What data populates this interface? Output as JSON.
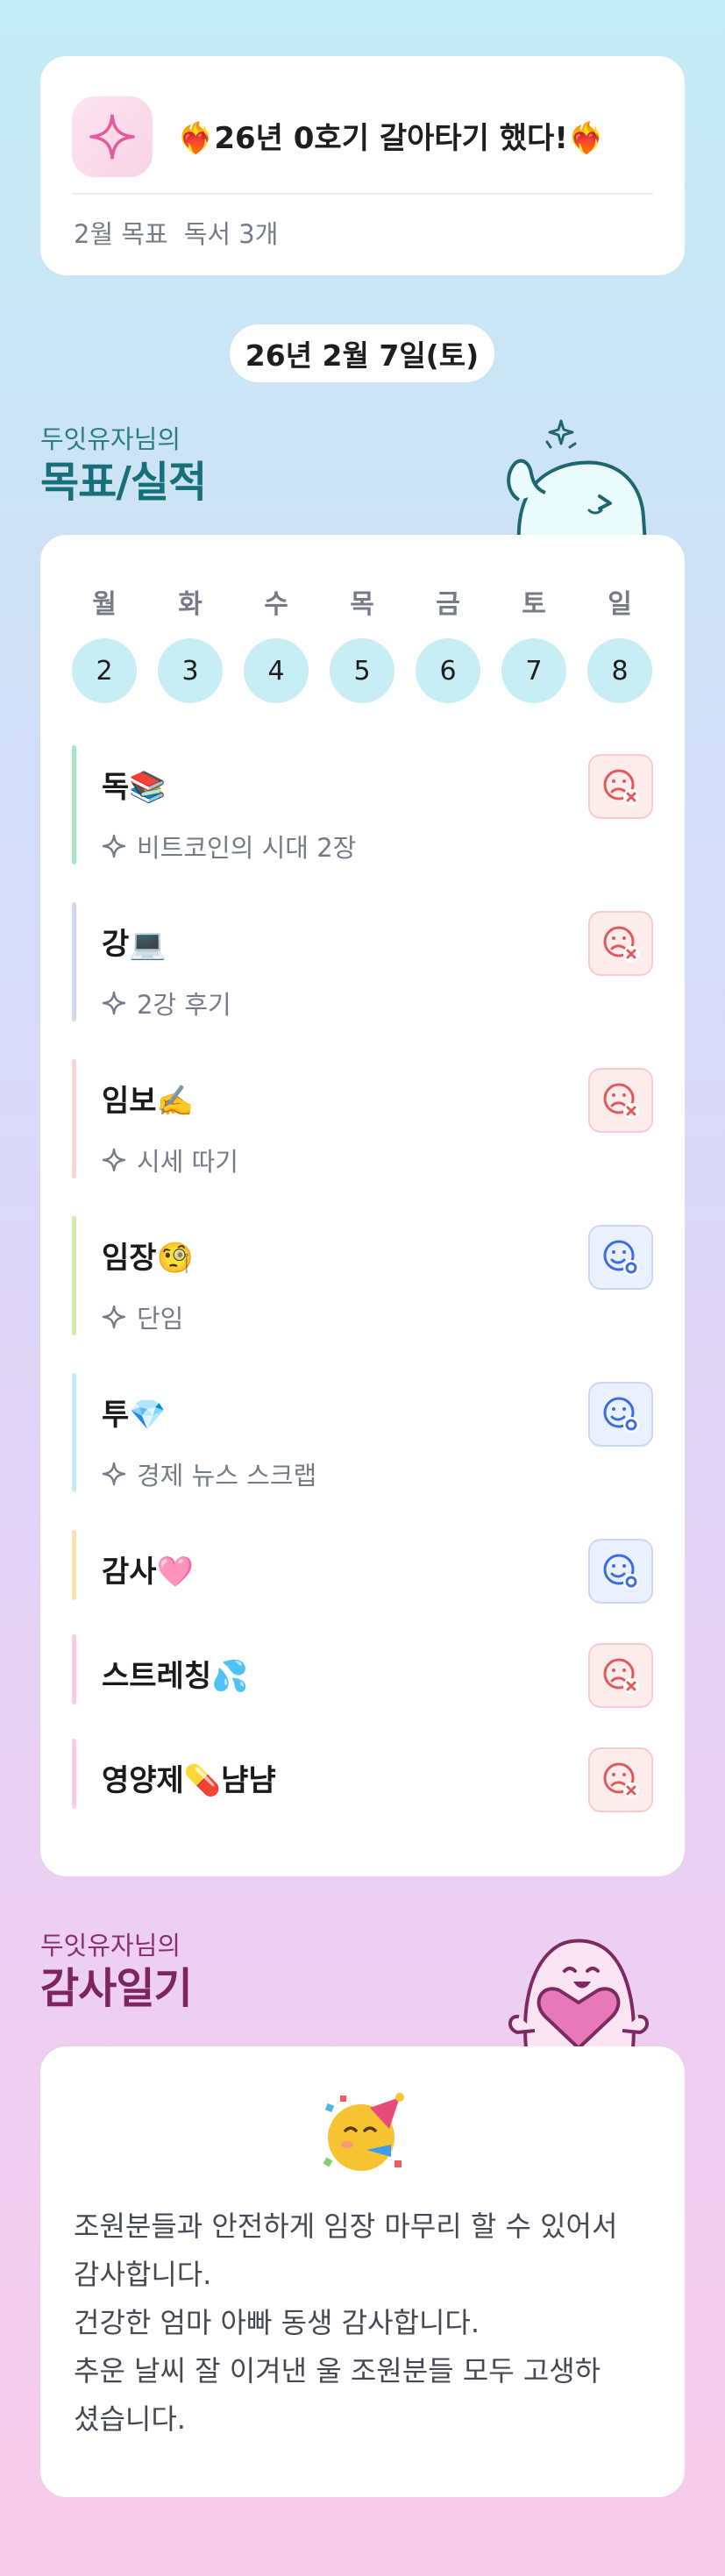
{
  "header": {
    "title": "❤️‍🔥26년 0호기 갈아타기 했다!❤️‍🔥",
    "goal_label": "2월 목표",
    "goal_value": "독서 3개",
    "icon": "sparkle-icon"
  },
  "date_label": "26년 2월 7일(토)",
  "goals_section": {
    "subtitle": "두잇유자님의",
    "title": "목표/실적"
  },
  "week": {
    "days": [
      "월",
      "화",
      "수",
      "목",
      "금",
      "토",
      "일"
    ],
    "dates": [
      "2",
      "3",
      "4",
      "5",
      "6",
      "7",
      "8"
    ]
  },
  "goals": [
    {
      "name": "독📚",
      "note": "비트코인의 시대 2장",
      "status": "fail",
      "bar_color": "#a6e6c9"
    },
    {
      "name": "강💻",
      "note": "2강 후기",
      "status": "fail",
      "bar_color": "#cfd6f6"
    },
    {
      "name": "임보✍️",
      "note": "시세 따기",
      "status": "fail",
      "bar_color": "#f9d6cf"
    },
    {
      "name": "임장🧐",
      "note": "단임",
      "status": "done",
      "bar_color": "#cdeea2"
    },
    {
      "name": "투💎",
      "note": "경제 뉴스 스크랩",
      "status": "done",
      "bar_color": "#c2ecf4"
    },
    {
      "name": "감사🩷",
      "note": "",
      "status": "done",
      "bar_color": "#fbe3b0"
    },
    {
      "name": "스트레칭💦",
      "note": "",
      "status": "fail",
      "bar_color": "#f9cde6"
    },
    {
      "name": "영양제💊냠냠",
      "note": "",
      "status": "fail",
      "bar_color": "#f9cde6"
    }
  ],
  "thanks_section": {
    "subtitle": "두잇유자님의",
    "title": "감사일기",
    "emoji": "partying-face-icon",
    "lines": [
      "조원분들과 안전하게 임장 마무리 할 수 있어서",
      "감사합니다.",
      "건강한 엄마 아빠 동생 감사합니다.",
      "추운 날씨 잘 이겨낸 울 조원분들 모두 고생하",
      "셨습니다."
    ]
  },
  "colors": {
    "fail": "#e05a5a",
    "done": "#3b6fe0",
    "goal_heading": "#176f77",
    "thanks_heading": "#7d255f"
  }
}
